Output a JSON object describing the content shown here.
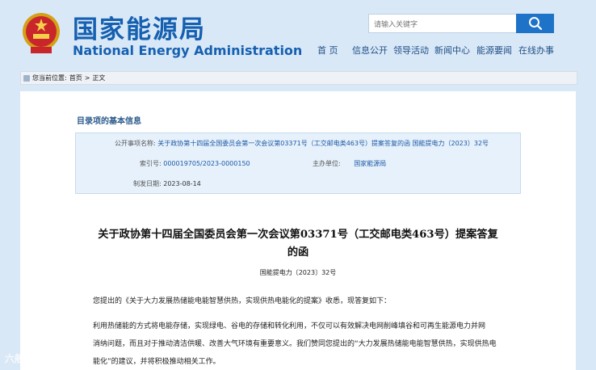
{
  "header": {
    "site_name_cn": "国家能源局",
    "site_name_en": "National Energy Administration",
    "emblem_icon": "national-emblem-icon"
  },
  "search": {
    "placeholder": "请输入关键字",
    "button_icon": "search-icon"
  },
  "nav": {
    "items": [
      "首 页",
      "信息公开",
      "领导活动",
      "新闻中心",
      "能源要闻",
      "在线办事"
    ]
  },
  "breadcrumb": {
    "prefix": "您当前位置:",
    "home": "首页",
    "sep": ">",
    "current": "正文"
  },
  "directory": {
    "title": "目录项的基本信息",
    "fields": {
      "subject_label": "公开事项名称:",
      "subject_value": "关于政协第十四届全国委员会第一次会议第03371号（工交邮电类463号）提案答复的函  国能提电力（2023）32号",
      "index_label": "索引号:",
      "index_value": "000019705/2023-0000150",
      "issuer_label": "主办单位:",
      "issuer_value": "国家能源局",
      "date_label": "制发日期:",
      "date_value": "2023-08-14"
    }
  },
  "article": {
    "title_line1": "关于政协第十四届全国委员会第一次会议第03371号（工交邮电类463号）提案答复",
    "title_line2": "的函",
    "doc_number": "国能提电力〔2023〕32号",
    "paragraphs": [
      "您提出的《关于大力发展热储能电能智慧供热，实现供热电能化的提案》收悉，现答复如下：",
      "利用热储能的方式将电能存储，实现绿电、谷电的存储和转化利用，不仅可以有效解决电网削峰填谷和可再生能源电力并网",
      "消纳问题，而且对于推动清洁供暖、改善大气环境有重要意义。我们赞同您提出的“大力发展热储能电能智慧供热，实现供热电",
      "能化”的建议，并将积极推动相关工作。"
    ]
  },
  "watermark": "六般荡漾",
  "colors": {
    "brand_blue": "#1560b0",
    "search_button": "#1e73c8",
    "info_bg": "#e6f1fb",
    "page_bg": "#d9e8f7"
  }
}
